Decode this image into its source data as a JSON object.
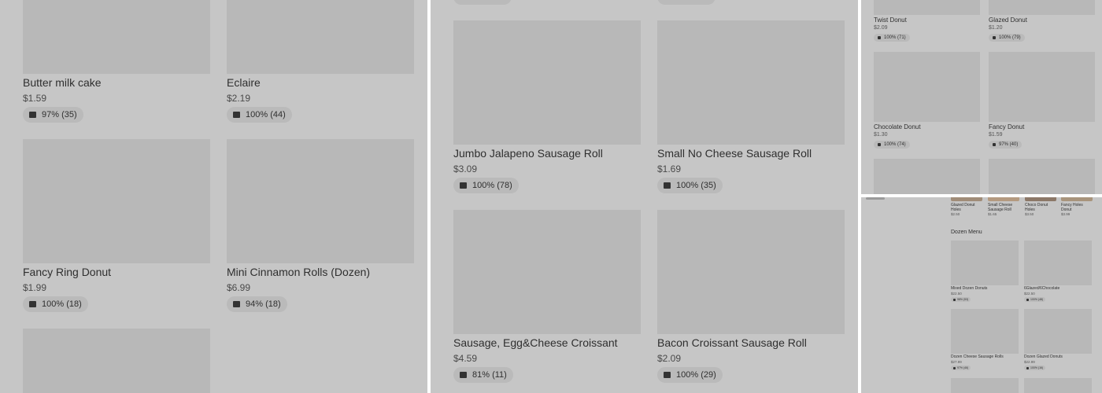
{
  "panel1": {
    "items": [
      {
        "name": "Butter milk cake",
        "price": "$1.59",
        "rating": "97% (35)"
      },
      {
        "name": "Eclaire",
        "price": "$2.19",
        "rating": "100% (44)"
      },
      {
        "name": "Fancy Ring Donut",
        "price": "$1.99",
        "rating": "100% (18)"
      },
      {
        "name": "Mini Cinnamon Rolls (Dozen)",
        "price": "$6.99",
        "rating": "94% (18)"
      }
    ]
  },
  "panel2": {
    "items": [
      {
        "name": "Jumbo Jalapeno Sausage Roll",
        "price": "$3.09",
        "rating": "100% (78)"
      },
      {
        "name": "Small No Cheese Sausage Roll",
        "price": "$1.69",
        "rating": "100% (35)"
      },
      {
        "name": "Sausage, Egg&Cheese Croissant",
        "price": "$4.59",
        "rating": "81% (11)"
      },
      {
        "name": "Bacon Croissant Sausage Roll",
        "price": "$2.09",
        "rating": "100% (29)"
      }
    ]
  },
  "panel3": {
    "items": [
      {
        "name": "Twist Donut",
        "price": "$2.09",
        "rating": "100% (71)"
      },
      {
        "name": "Glazed Donut",
        "price": "$1.20",
        "rating": "100% (79)"
      },
      {
        "name": "Chocolate Donut",
        "price": "$1.30",
        "rating": "100% (74)"
      },
      {
        "name": "Fancy Donut",
        "price": "$1.59",
        "rating": "97% (40)"
      }
    ]
  },
  "panel4": {
    "top_items": [
      {
        "name": "Glazed Donut Holes",
        "price": "$2.50"
      },
      {
        "name": "Small Cheese Sausage Roll",
        "price": "$1.65"
      },
      {
        "name": "Choco Donut Holes",
        "price": "$3.50"
      },
      {
        "name": "Fancy Holes Donut",
        "price": "$3.99"
      }
    ],
    "section_title": "Dozen Menu",
    "items": [
      {
        "name": "Mixed Dozen Donuts",
        "price": "$22.50",
        "rating": "98% (53)"
      },
      {
        "name": "6Glazed/6Chocolate",
        "price": "$22.50",
        "rating": "100% (48)"
      },
      {
        "name": "Dozen Cheese Sausage Rolls",
        "price": "$27.99",
        "rating": "97% (46)"
      },
      {
        "name": "Dozen Glazed Donuts",
        "price": "$22.99",
        "rating": "100% (16)"
      }
    ]
  }
}
